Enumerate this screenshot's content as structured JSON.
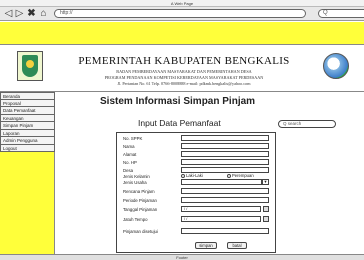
{
  "window": {
    "title": "A Web Page"
  },
  "browser": {
    "address": "http://",
    "icons": [
      "back-icon",
      "forward-icon",
      "close-icon",
      "home-icon"
    ],
    "search_placeholder": "Q"
  },
  "header": {
    "title": "PEMERINTAH KABUPATEN BENGKALIS",
    "line1": "BADAN PEMBERDAYAAN MASYARAKAT DAN PEMERINTAHAN DESA",
    "line2": "PROGRAM PENDANAAN KOMPETISI KEBERDAYAAN MASYARAKAT PERDESAAN",
    "line3": "Jl. Pertanian No. 61 Telp. 0766-8008888 e-mail: pdkmk.bengkalis@yahoo.com"
  },
  "sidebar": {
    "items": [
      {
        "label": "Beranda"
      },
      {
        "label": "Proposal"
      },
      {
        "label": "Data Pemanfaat"
      },
      {
        "label": "Keuangan"
      },
      {
        "label": "Simpan Pinjam"
      },
      {
        "label": "Laporan"
      },
      {
        "label": "Admin Pengguna"
      },
      {
        "label": "Logout"
      }
    ]
  },
  "main": {
    "title": "Sistem Informasi Simpan Pinjam",
    "form_title": "Input Data Pemanfaat",
    "search_placeholder": "Q search"
  },
  "form": {
    "fields": [
      {
        "label": "No. SPPK"
      },
      {
        "label": "Nama"
      },
      {
        "label": "Alamat"
      },
      {
        "label": "No. HP"
      },
      {
        "label": "Desa"
      },
      {
        "label": "Jenis Kelamin"
      },
      {
        "label": "Jenis Usaha"
      },
      {
        "label": "Rencana Pinjam"
      },
      {
        "label": "Periode Pinjaman"
      },
      {
        "label": "Tanggal Pinjaman",
        "value": "/  /"
      },
      {
        "label": "Jatuh Tempo",
        "value": "/  /"
      },
      {
        "label": "Pinjaman disetujui"
      }
    ],
    "gender_options": [
      "Laki-Laki",
      "Perempuan"
    ],
    "buttons": {
      "save": "simpan",
      "cancel": "batal"
    }
  },
  "footer": {
    "text": "Footer"
  },
  "colors": {
    "accent": "#ffff3a",
    "border": "#444444"
  }
}
